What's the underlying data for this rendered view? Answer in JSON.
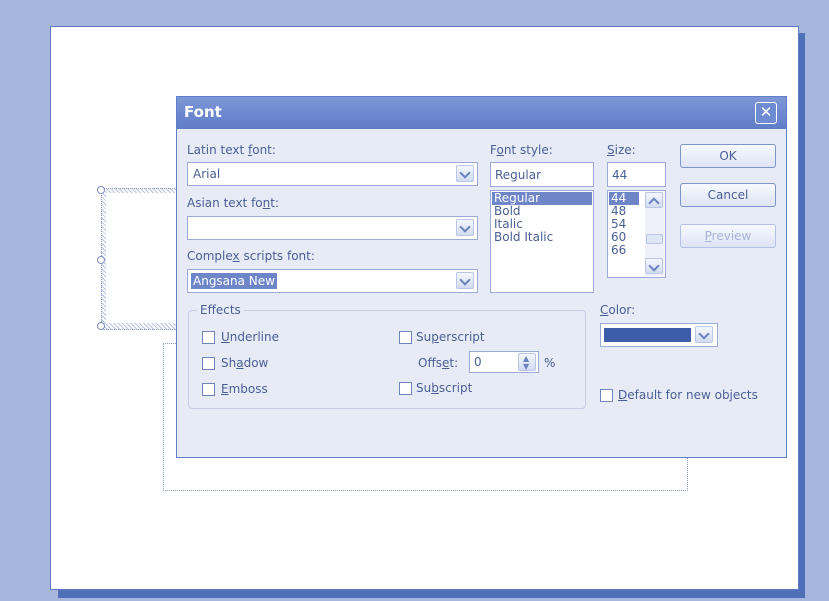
{
  "dialog": {
    "title": "Font",
    "close_glyph": "✕",
    "latin": {
      "label_pre": "Latin text ",
      "label_key": "f",
      "label_post": "ont:",
      "value": "Arial"
    },
    "asian": {
      "label_pre": "Asian text fo",
      "label_key": "n",
      "label_post": "t:",
      "value": ""
    },
    "complex": {
      "label_pre": "Comple",
      "label_key": "x",
      "label_post": " scripts font:",
      "value": "Angsana New"
    },
    "style": {
      "label_pre": "F",
      "label_key": "o",
      "label_post": "nt style:",
      "value": "Regular",
      "options": [
        "Regular",
        "Bold",
        "Italic",
        "Bold Italic"
      ],
      "selected": "Regular"
    },
    "size": {
      "label_key": "S",
      "label_post": "ize:",
      "value": "44",
      "options": [
        "44",
        "48",
        "54",
        "60",
        "66"
      ],
      "selected": "44"
    },
    "buttons": {
      "ok": "OK",
      "cancel": "Cancel",
      "preview_key": "P",
      "preview_post": "review"
    },
    "effects": {
      "legend": "Effects",
      "underline": {
        "key": "U",
        "post": "nderline",
        "checked": false
      },
      "shadow": {
        "pre": "Sh",
        "key": "a",
        "post": "dow",
        "checked": false
      },
      "emboss": {
        "key": "E",
        "post": "mboss",
        "checked": false
      },
      "superscript": {
        "pre": "Su",
        "key": "p",
        "post": "erscript",
        "checked": false
      },
      "offset": {
        "pre": "Offs",
        "key": "e",
        "post": "t:",
        "value": "0",
        "unit": "%"
      },
      "subscript": {
        "pre": "Su",
        "key": "b",
        "post": "script",
        "checked": false
      }
    },
    "color": {
      "label_key": "C",
      "label_post": "olor:",
      "value": "#3c5da9"
    },
    "default_objects": {
      "key": "D",
      "post": "efault for new objects",
      "checked": false
    }
  }
}
